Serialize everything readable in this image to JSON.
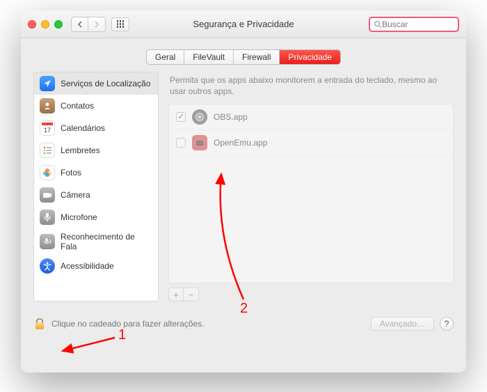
{
  "window": {
    "title": "Segurança e Privacidade",
    "search_placeholder": "Buscar"
  },
  "tabs": [
    {
      "label": "Geral"
    },
    {
      "label": "FileVault"
    },
    {
      "label": "Firewall"
    },
    {
      "label": "Privacidade",
      "active": true
    }
  ],
  "sidebar": {
    "items": [
      {
        "label": "Serviços de Localização",
        "icon": "location",
        "selected": true
      },
      {
        "label": "Contatos",
        "icon": "contacts"
      },
      {
        "label": "Calendários",
        "icon": "calendar"
      },
      {
        "label": "Lembretes",
        "icon": "reminders"
      },
      {
        "label": "Fotos",
        "icon": "photos"
      },
      {
        "label": "Câmera",
        "icon": "camera"
      },
      {
        "label": "Microfone",
        "icon": "microphone"
      },
      {
        "label": "Reconhecimento de Fala",
        "icon": "speech"
      },
      {
        "label": "Acessibilidade",
        "icon": "accessibility"
      }
    ]
  },
  "main": {
    "description": "Permita que os apps abaixo monitorem a entrada do teclado, mesmo ao usar outros apps.",
    "apps": [
      {
        "name": "OBS.app",
        "checked": true
      },
      {
        "name": "OpenEmu.app",
        "checked": false
      }
    ]
  },
  "footer": {
    "lock_text": "Clique no cadeado para fazer alterações.",
    "advanced_label": "Avançado…"
  },
  "annotations": {
    "label1": "1",
    "label2": "2"
  }
}
